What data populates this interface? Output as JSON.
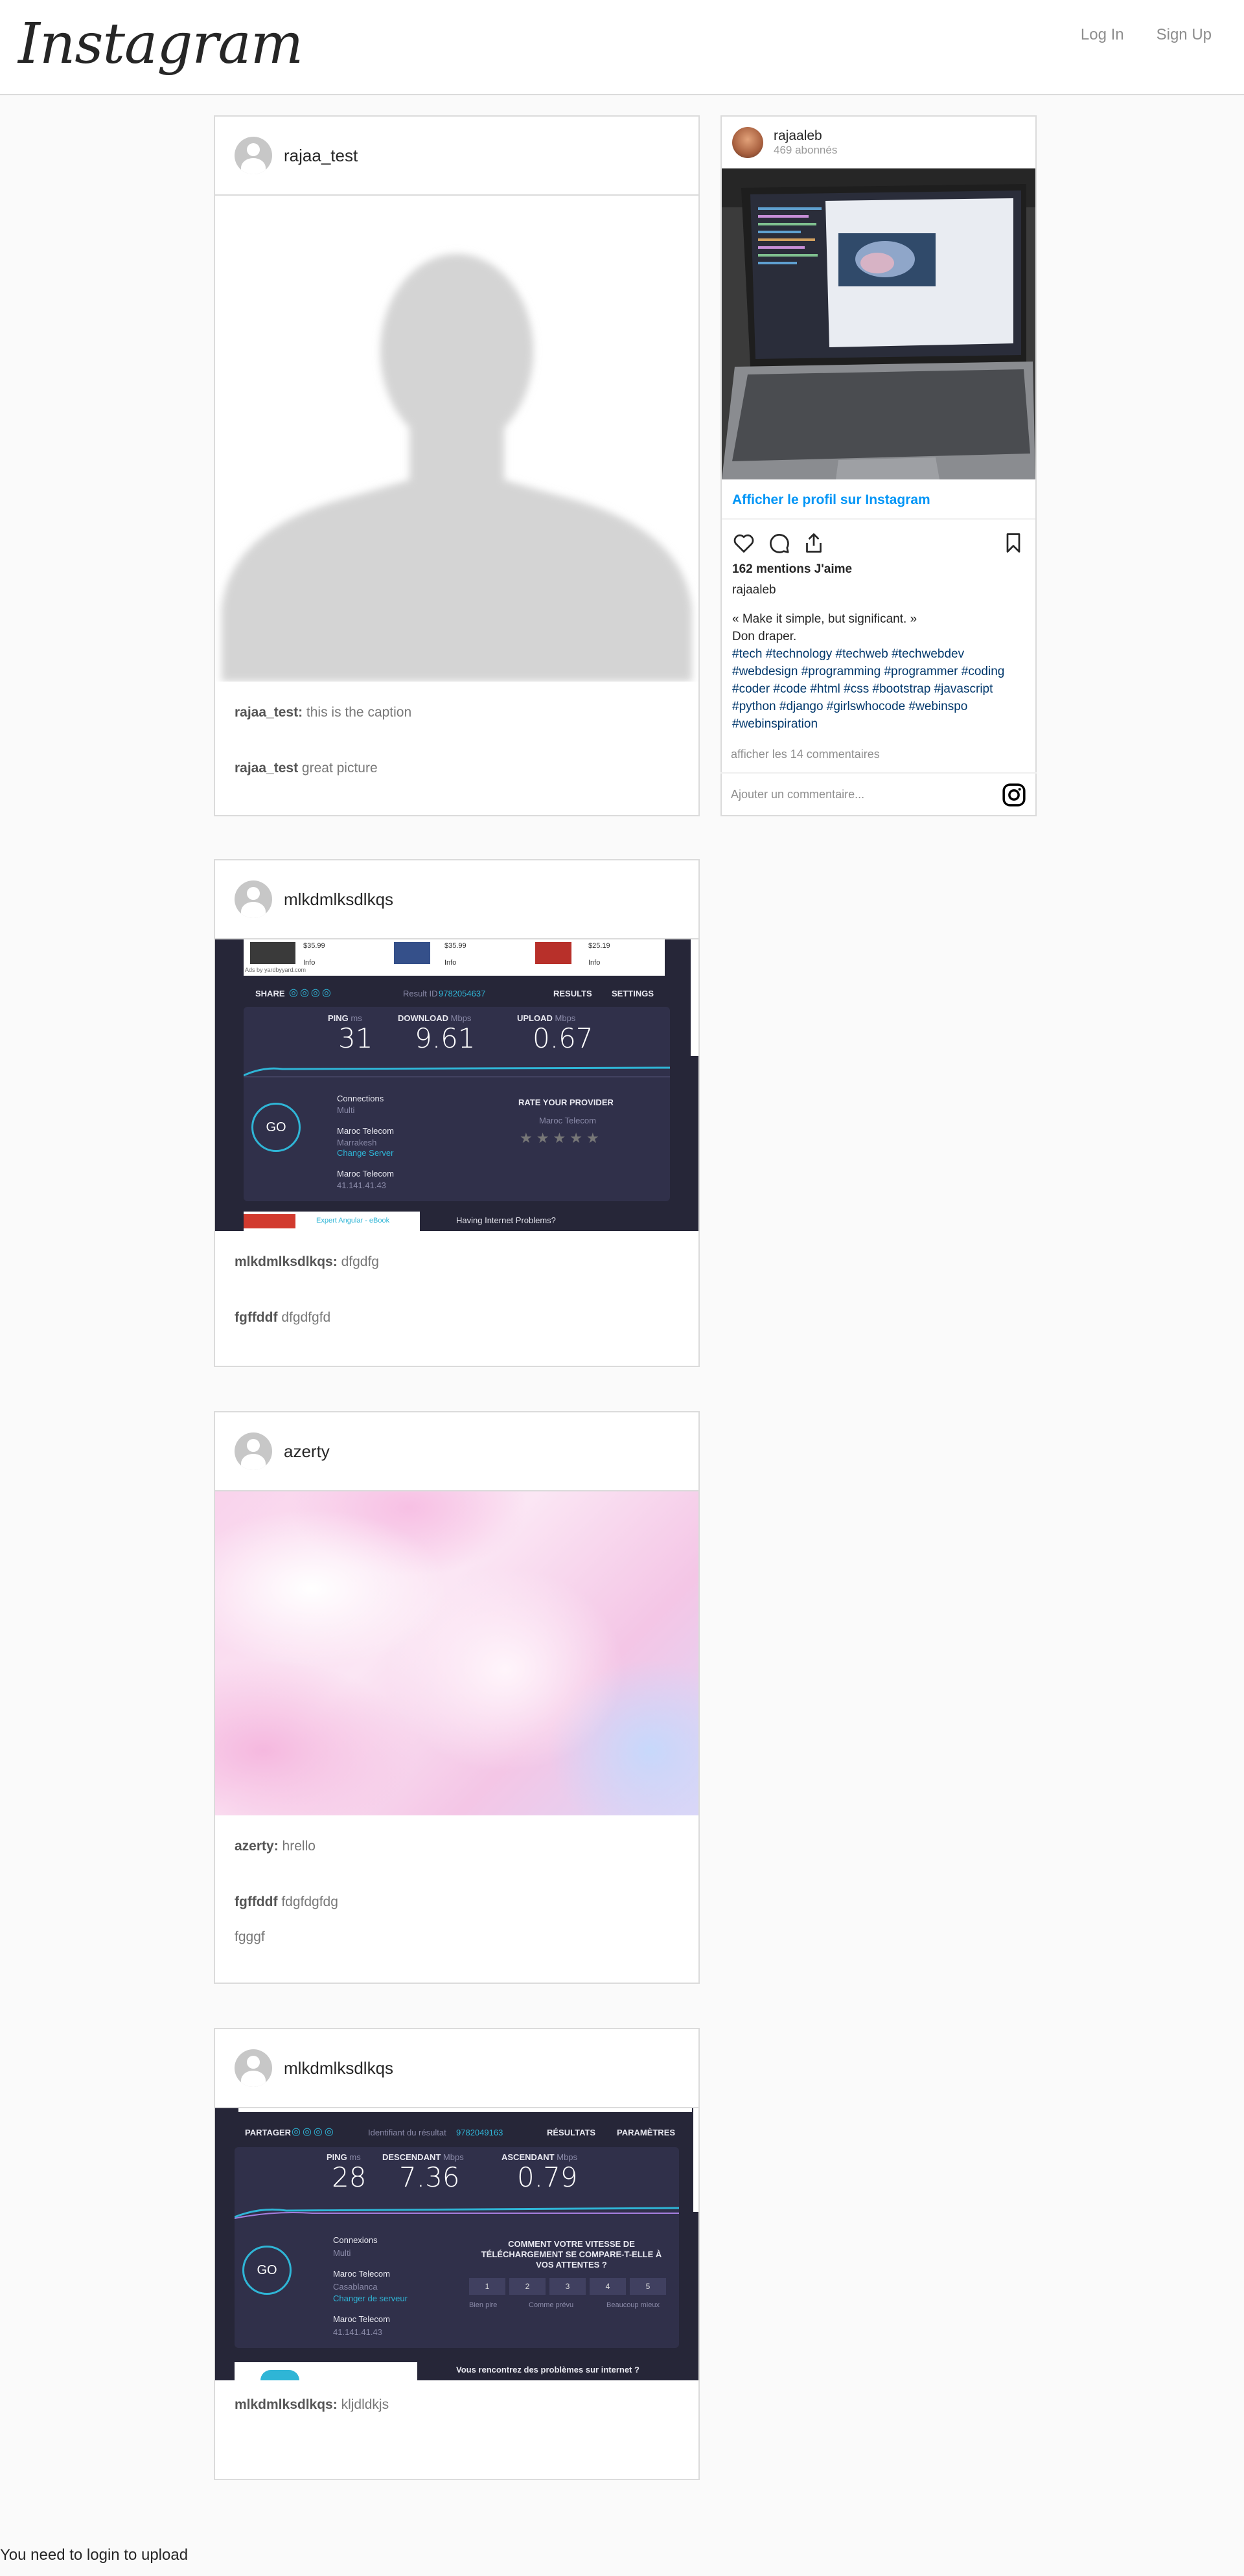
{
  "header": {
    "logo": "Instagram",
    "login_label": "Log In",
    "signup_label": "Sign Up"
  },
  "posts": [
    {
      "username": "rajaa_test",
      "image": "profile-silhouette-placeholder",
      "caption_user": "rajaa_test:",
      "caption_text": "this is the caption",
      "comments": [
        {
          "user": "rajaa_test",
          "text": "great picture"
        }
      ]
    },
    {
      "username": "mlkdmlksdlkqs",
      "image": "speedtest-screenshot",
      "caption_user": "mlkdmlksdlkqs:",
      "caption_text": "dfgdfg",
      "comments": [
        {
          "user": "fgffddf",
          "text": "dfgdfgfd"
        }
      ],
      "speedtest": {
        "share": "SHARE",
        "result_id_label": "Result ID",
        "result_id": "9782054637",
        "results": "RESULTS",
        "settings": "SETTINGS",
        "ping_label": "PING",
        "ping_unit": "ms",
        "download_label": "DOWNLOAD",
        "download_unit": "Mbps",
        "upload_label": "UPLOAD",
        "upload_unit": "Mbps",
        "ping": "31",
        "download": "9.61",
        "upload": "0.67",
        "connections_label": "Connections",
        "connections_value": "Multi",
        "isp": "Maroc Telecom",
        "city": "Marrakesh",
        "change_server": "Change Server",
        "host": "Maroc Telecom",
        "ip": "41.141.41.43",
        "rate_label": "RATE YOUR PROVIDER",
        "rate_provider": "Maroc Telecom",
        "problem_text": "Having Internet Problems?",
        "ad_label": "Expert Angular - eBook",
        "ad_prices": [
          "$35.99",
          "$35.99",
          "$25.19"
        ],
        "ad_info": "Info",
        "ad_url": "Ads by yardbyyard.com"
      }
    },
    {
      "username": "azerty",
      "image": "pink-watercolor-texture",
      "caption_user": "azerty:",
      "caption_text": "hrello",
      "comments": [
        {
          "user": "fgffddf",
          "text": "fdgfdgfdg"
        },
        {
          "user": "",
          "text": "fgggf"
        }
      ]
    },
    {
      "username": "mlkdmlksdlkqs",
      "image": "speedtest-screenshot-fr",
      "caption_user": "mlkdmlksdlkqs:",
      "caption_text": "kljdldkjs",
      "comments": [],
      "speedtest": {
        "share": "PARTAGER",
        "result_id_label": "Identifiant du résultat",
        "result_id": "9782049163",
        "results": "RÉSULTATS",
        "settings": "PARAMÈTRES",
        "ping_label": "PING",
        "ping_unit": "ms",
        "download_label": "DESCENDANT",
        "download_unit": "Mbps",
        "upload_label": "ASCENDANT",
        "upload_unit": "Mbps",
        "ping": "28",
        "download": "7.36",
        "upload": "0.79",
        "connections_label": "Connexions",
        "connections_value": "Multi",
        "isp": "Maroc Telecom",
        "city": "Casablanca",
        "change_server": "Changer de serveur",
        "host": "Maroc Telecom",
        "ip": "41.141.41.43",
        "rate_label": "COMMENT VOTRE VITESSE DE TÉLÉCHARGEMENT SE COMPARE-T-ELLE À VOS ATTENTES ?",
        "rating_options": [
          "1",
          "2",
          "3",
          "4",
          "5"
        ],
        "rating_scale": [
          "Bien pire",
          "Comme prévu",
          "Beaucoup mieux"
        ],
        "problem_text": "Vous rencontrez des problèmes sur internet ?"
      }
    }
  ],
  "embed": {
    "username": "rajaaleb",
    "followers": "469 abonnés",
    "photo": "laptop-code-editor-photo",
    "profile_link": "Afficher le profil sur Instagram",
    "likes": "162 mentions J'aime",
    "caption_user": "rajaaleb",
    "caption_lines": [
      "« Make it simple, but significant. »",
      "Don draper."
    ],
    "hashtags": "#tech #technology #techweb #techwebdev #webdesign #programming #programmer #coding #coder #code #html #css #bootstrap #javascript #python #django #girlswhocode #webinspo #webinspiration",
    "view_comments": "afficher les 14 commentaires",
    "comment_placeholder": "Ajouter un commentaire..."
  },
  "footer": {
    "message": "You need to login to upload"
  },
  "colors": {
    "link_blue": "#0095f6",
    "hashtag_blue": "#00376b",
    "border": "#dbdbdb",
    "background": "#fafafa"
  }
}
